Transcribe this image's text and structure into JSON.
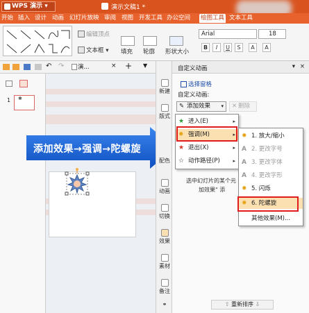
{
  "title_bar": {
    "app": "WPS 演示",
    "document": "演示文稿1 *"
  },
  "menu_bar": [
    "开始",
    "插入",
    "设计",
    "动画",
    "幻灯片放映",
    "审阅",
    "视图",
    "开发工具",
    "办公空间",
    "绘图工具",
    "文本工具"
  ],
  "ribbon": {
    "edit_points": "编辑顶点",
    "textbox": "文本框",
    "fill": "填充",
    "outline": "轮廓",
    "shape_effects": "形状大小",
    "font": "Arial",
    "size": "18",
    "format_buttons": [
      "B",
      "I",
      "U",
      "S",
      "A",
      "A"
    ]
  },
  "left_panel": {
    "tab_label": "演...",
    "thumb_number": "1"
  },
  "callout": "添加效果→强调→陀螺旋",
  "tool_strip": [
    "新建",
    "版式",
    "配色",
    "动画",
    "切换",
    "效果",
    "素材",
    "备注"
  ],
  "right_pane": {
    "header": "自定义动画",
    "select_pane": "选择窗格",
    "custom_anim_label": "自定义动画:",
    "add_effect": "添加效果",
    "delete": "删除",
    "hint_line1": "选中幻灯片的某个元",
    "hint_line2": "加效果\" 添",
    "reorder": "重新排序"
  },
  "menu1": [
    {
      "label": "进入(E)",
      "icon": "star-green-icon"
    },
    {
      "label": "强调(M)",
      "icon": "star-yellow-icon"
    },
    {
      "label": "退出(X)",
      "icon": "star-red-icon"
    },
    {
      "label": "动作路径(P)",
      "icon": "star-outline-icon"
    }
  ],
  "menu2": [
    {
      "label": "1. 放大/缩小",
      "enabled": true
    },
    {
      "label": "2. 更改字号",
      "enabled": false
    },
    {
      "label": "3. 更改字体",
      "enabled": false
    },
    {
      "label": "4. 更改字形",
      "enabled": false
    },
    {
      "label": "5. 闪烁",
      "enabled": true
    },
    {
      "label": "6. 陀螺旋",
      "enabled": true
    },
    {
      "label": "其他效果(M)...",
      "enabled": true
    }
  ],
  "colors": {
    "title_bar": "#d9531e",
    "menu_bar": "#e7622c",
    "highlight_border": "#e01b1b",
    "callout_blue": "#1e63d8",
    "selection": "#fbe0b2"
  }
}
